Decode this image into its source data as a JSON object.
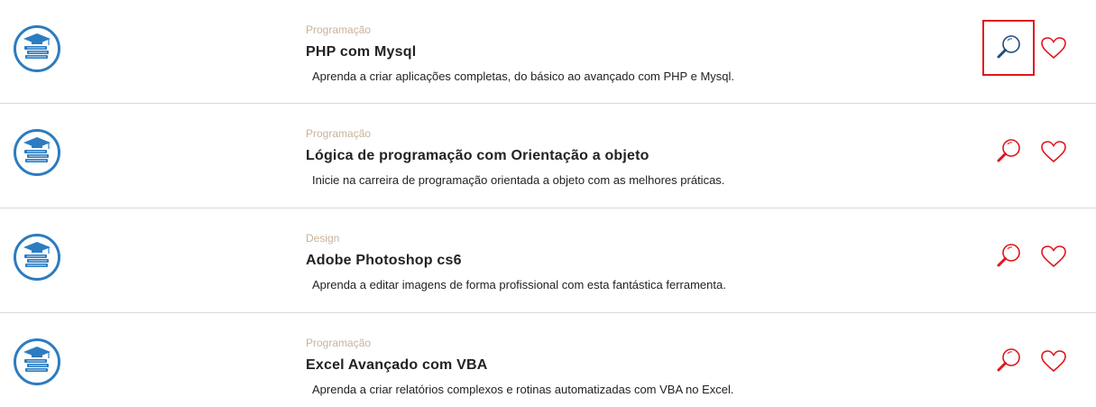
{
  "colors": {
    "category": "#c9b29a",
    "title": "#222222",
    "icon_blue": "#2c7cc1",
    "action_red": "#e0161c",
    "search_active": "#1f4e79"
  },
  "courses": [
    {
      "category": "Programação",
      "title": "PHP com Mysql",
      "description": "Aprenda a criar aplicações completas, do básico ao avançado com PHP e Mysql.",
      "icon": "graduation-books-icon",
      "search_selected": true
    },
    {
      "category": "Programação",
      "title": "Lógica de programação com Orientação a objeto",
      "description": "Inicie na carreira de programação orientada a objeto com as melhores práticas.",
      "icon": "graduation-books-icon",
      "search_selected": false
    },
    {
      "category": "Design",
      "title": "Adobe Photoshop cs6",
      "description": "Aprenda a editar imagens de forma profissional com esta fantástica ferramenta.",
      "icon": "graduation-books-icon",
      "search_selected": false
    },
    {
      "category": "Programação",
      "title": "Excel Avançado com VBA",
      "description": "Aprenda a criar relatórios complexos e rotinas automatizadas com VBA no Excel.",
      "icon": "graduation-books-icon",
      "search_selected": false
    }
  ]
}
